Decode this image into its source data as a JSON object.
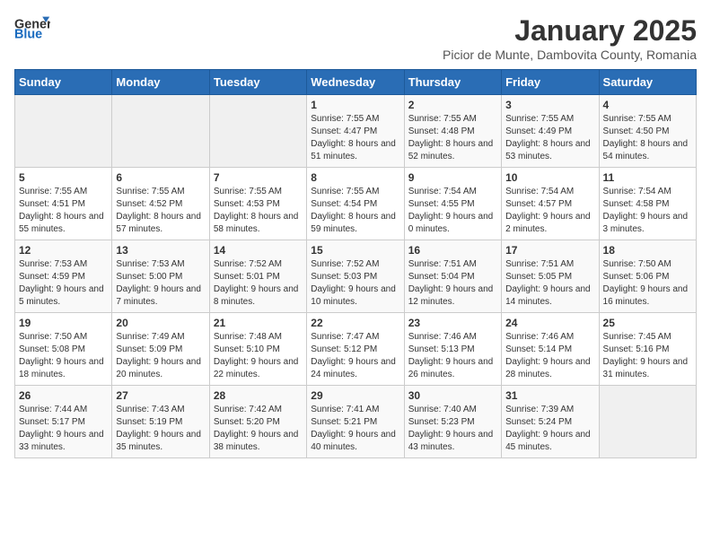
{
  "logo": {
    "general": "General",
    "blue": "Blue"
  },
  "title": {
    "month_year": "January 2025",
    "location": "Picior de Munte, Dambovita County, Romania"
  },
  "weekdays": [
    "Sunday",
    "Monday",
    "Tuesday",
    "Wednesday",
    "Thursday",
    "Friday",
    "Saturday"
  ],
  "weeks": [
    [
      {
        "day": "",
        "sunrise": "",
        "sunset": "",
        "daylight": ""
      },
      {
        "day": "",
        "sunrise": "",
        "sunset": "",
        "daylight": ""
      },
      {
        "day": "",
        "sunrise": "",
        "sunset": "",
        "daylight": ""
      },
      {
        "day": "1",
        "sunrise": "Sunrise: 7:55 AM",
        "sunset": "Sunset: 4:47 PM",
        "daylight": "Daylight: 8 hours and 51 minutes."
      },
      {
        "day": "2",
        "sunrise": "Sunrise: 7:55 AM",
        "sunset": "Sunset: 4:48 PM",
        "daylight": "Daylight: 8 hours and 52 minutes."
      },
      {
        "day": "3",
        "sunrise": "Sunrise: 7:55 AM",
        "sunset": "Sunset: 4:49 PM",
        "daylight": "Daylight: 8 hours and 53 minutes."
      },
      {
        "day": "4",
        "sunrise": "Sunrise: 7:55 AM",
        "sunset": "Sunset: 4:50 PM",
        "daylight": "Daylight: 8 hours and 54 minutes."
      }
    ],
    [
      {
        "day": "5",
        "sunrise": "Sunrise: 7:55 AM",
        "sunset": "Sunset: 4:51 PM",
        "daylight": "Daylight: 8 hours and 55 minutes."
      },
      {
        "day": "6",
        "sunrise": "Sunrise: 7:55 AM",
        "sunset": "Sunset: 4:52 PM",
        "daylight": "Daylight: 8 hours and 57 minutes."
      },
      {
        "day": "7",
        "sunrise": "Sunrise: 7:55 AM",
        "sunset": "Sunset: 4:53 PM",
        "daylight": "Daylight: 8 hours and 58 minutes."
      },
      {
        "day": "8",
        "sunrise": "Sunrise: 7:55 AM",
        "sunset": "Sunset: 4:54 PM",
        "daylight": "Daylight: 8 hours and 59 minutes."
      },
      {
        "day": "9",
        "sunrise": "Sunrise: 7:54 AM",
        "sunset": "Sunset: 4:55 PM",
        "daylight": "Daylight: 9 hours and 0 minutes."
      },
      {
        "day": "10",
        "sunrise": "Sunrise: 7:54 AM",
        "sunset": "Sunset: 4:57 PM",
        "daylight": "Daylight: 9 hours and 2 minutes."
      },
      {
        "day": "11",
        "sunrise": "Sunrise: 7:54 AM",
        "sunset": "Sunset: 4:58 PM",
        "daylight": "Daylight: 9 hours and 3 minutes."
      }
    ],
    [
      {
        "day": "12",
        "sunrise": "Sunrise: 7:53 AM",
        "sunset": "Sunset: 4:59 PM",
        "daylight": "Daylight: 9 hours and 5 minutes."
      },
      {
        "day": "13",
        "sunrise": "Sunrise: 7:53 AM",
        "sunset": "Sunset: 5:00 PM",
        "daylight": "Daylight: 9 hours and 7 minutes."
      },
      {
        "day": "14",
        "sunrise": "Sunrise: 7:52 AM",
        "sunset": "Sunset: 5:01 PM",
        "daylight": "Daylight: 9 hours and 8 minutes."
      },
      {
        "day": "15",
        "sunrise": "Sunrise: 7:52 AM",
        "sunset": "Sunset: 5:03 PM",
        "daylight": "Daylight: 9 hours and 10 minutes."
      },
      {
        "day": "16",
        "sunrise": "Sunrise: 7:51 AM",
        "sunset": "Sunset: 5:04 PM",
        "daylight": "Daylight: 9 hours and 12 minutes."
      },
      {
        "day": "17",
        "sunrise": "Sunrise: 7:51 AM",
        "sunset": "Sunset: 5:05 PM",
        "daylight": "Daylight: 9 hours and 14 minutes."
      },
      {
        "day": "18",
        "sunrise": "Sunrise: 7:50 AM",
        "sunset": "Sunset: 5:06 PM",
        "daylight": "Daylight: 9 hours and 16 minutes."
      }
    ],
    [
      {
        "day": "19",
        "sunrise": "Sunrise: 7:50 AM",
        "sunset": "Sunset: 5:08 PM",
        "daylight": "Daylight: 9 hours and 18 minutes."
      },
      {
        "day": "20",
        "sunrise": "Sunrise: 7:49 AM",
        "sunset": "Sunset: 5:09 PM",
        "daylight": "Daylight: 9 hours and 20 minutes."
      },
      {
        "day": "21",
        "sunrise": "Sunrise: 7:48 AM",
        "sunset": "Sunset: 5:10 PM",
        "daylight": "Daylight: 9 hours and 22 minutes."
      },
      {
        "day": "22",
        "sunrise": "Sunrise: 7:47 AM",
        "sunset": "Sunset: 5:12 PM",
        "daylight": "Daylight: 9 hours and 24 minutes."
      },
      {
        "day": "23",
        "sunrise": "Sunrise: 7:46 AM",
        "sunset": "Sunset: 5:13 PM",
        "daylight": "Daylight: 9 hours and 26 minutes."
      },
      {
        "day": "24",
        "sunrise": "Sunrise: 7:46 AM",
        "sunset": "Sunset: 5:14 PM",
        "daylight": "Daylight: 9 hours and 28 minutes."
      },
      {
        "day": "25",
        "sunrise": "Sunrise: 7:45 AM",
        "sunset": "Sunset: 5:16 PM",
        "daylight": "Daylight: 9 hours and 31 minutes."
      }
    ],
    [
      {
        "day": "26",
        "sunrise": "Sunrise: 7:44 AM",
        "sunset": "Sunset: 5:17 PM",
        "daylight": "Daylight: 9 hours and 33 minutes."
      },
      {
        "day": "27",
        "sunrise": "Sunrise: 7:43 AM",
        "sunset": "Sunset: 5:19 PM",
        "daylight": "Daylight: 9 hours and 35 minutes."
      },
      {
        "day": "28",
        "sunrise": "Sunrise: 7:42 AM",
        "sunset": "Sunset: 5:20 PM",
        "daylight": "Daylight: 9 hours and 38 minutes."
      },
      {
        "day": "29",
        "sunrise": "Sunrise: 7:41 AM",
        "sunset": "Sunset: 5:21 PM",
        "daylight": "Daylight: 9 hours and 40 minutes."
      },
      {
        "day": "30",
        "sunrise": "Sunrise: 7:40 AM",
        "sunset": "Sunset: 5:23 PM",
        "daylight": "Daylight: 9 hours and 43 minutes."
      },
      {
        "day": "31",
        "sunrise": "Sunrise: 7:39 AM",
        "sunset": "Sunset: 5:24 PM",
        "daylight": "Daylight: 9 hours and 45 minutes."
      },
      {
        "day": "",
        "sunrise": "",
        "sunset": "",
        "daylight": ""
      }
    ]
  ]
}
